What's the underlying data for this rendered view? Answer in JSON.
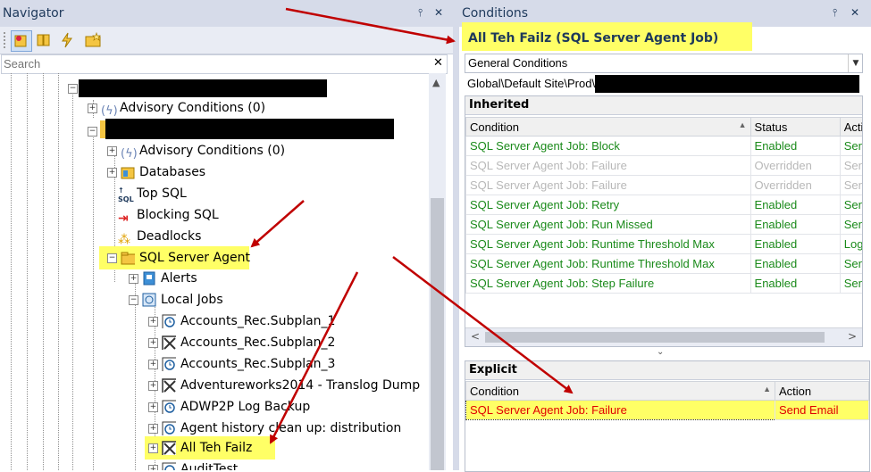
{
  "navigator": {
    "title": "Navigator",
    "pin": "📌",
    "close": "✕",
    "search_placeholder": "Search",
    "search_clear": "✕",
    "tree": [
      {
        "label": "Advisory Conditions (0)"
      },
      {
        "label": "Advisory Conditions (0)"
      },
      {
        "label": "Databases"
      },
      {
        "label": "Top SQL"
      },
      {
        "label": "Blocking SQL"
      },
      {
        "label": "Deadlocks"
      },
      {
        "label": "SQL Server Agent"
      },
      {
        "label": "Alerts"
      },
      {
        "label": "Local Jobs"
      },
      {
        "label": "Accounts_Rec.Subplan_1"
      },
      {
        "label": "Accounts_Rec.Subplan_2"
      },
      {
        "label": "Accounts_Rec.Subplan_3"
      },
      {
        "label": "Adventureworks2014 - Translog Dump"
      },
      {
        "label": "ADWP2P Log Backup"
      },
      {
        "label": "Agent history clean up: distribution"
      },
      {
        "label": "All Teh Failz"
      },
      {
        "label": "AuditTest"
      }
    ]
  },
  "conditions": {
    "title": "Conditions",
    "pin": "📌",
    "close": "✕",
    "heading": "All Teh Failz (SQL Server Agent Job)",
    "dropdown_value": "General Conditions",
    "path": "Global\\Default Site\\Prod\\",
    "inherited": {
      "title": "Inherited",
      "columns": [
        "Condition",
        "Status",
        "Action"
      ],
      "rows": [
        {
          "condition": "SQL Server Agent Job: Block",
          "status": "Enabled",
          "action": "Send Email",
          "state": "enabled"
        },
        {
          "condition": "SQL Server Agent Job: Failure",
          "status": "Overridden",
          "action": "Send Email",
          "state": "overridden"
        },
        {
          "condition": "SQL Server Agent Job: Failure",
          "status": "Overridden",
          "action": "Send Email",
          "state": "overridden"
        },
        {
          "condition": "SQL Server Agent Job: Retry",
          "status": "Enabled",
          "action": "Send Email",
          "state": "enabled"
        },
        {
          "condition": "SQL Server Agent Job: Run Missed",
          "status": "Enabled",
          "action": "Send Email",
          "state": "enabled"
        },
        {
          "condition": "SQL Server Agent Job: Runtime Threshold Max",
          "status": "Enabled",
          "action": "Log To Data",
          "state": "enabled"
        },
        {
          "condition": "SQL Server Agent Job: Runtime Threshold Max",
          "status": "Enabled",
          "action": "Send Email",
          "state": "enabled"
        },
        {
          "condition": "SQL Server Agent Job: Step Failure",
          "status": "Enabled",
          "action": "Send Email",
          "state": "enabled"
        }
      ]
    },
    "explicit": {
      "title": "Explicit",
      "columns": [
        "Condition",
        "Action"
      ],
      "rows": [
        {
          "condition": "SQL Server Agent Job: Failure",
          "action": "Send Email"
        }
      ]
    }
  },
  "colors": {
    "highlight": "#ffff66",
    "enabled": "#1a8a1a",
    "overridden": "#b8b8b8",
    "explicit_text": "#e00000",
    "annotation_arrow": "#c00000"
  }
}
